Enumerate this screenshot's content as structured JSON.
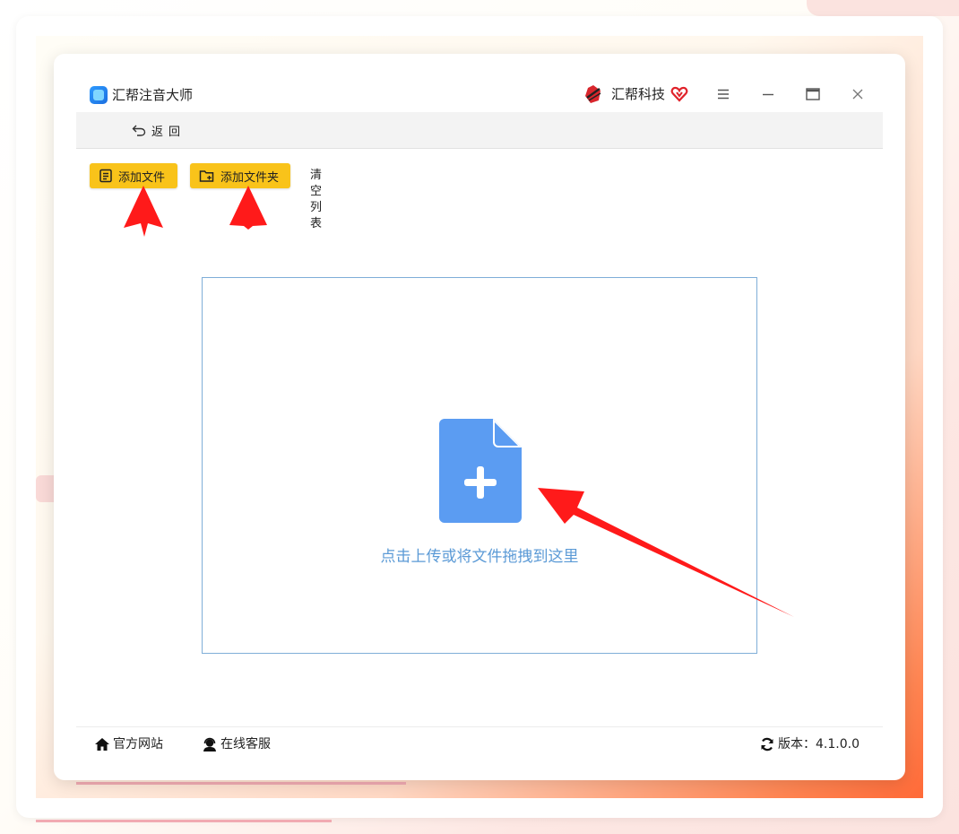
{
  "window": {
    "app_title": "汇帮注音大师",
    "brand_name": "汇帮科技"
  },
  "nav": {
    "back_label": "返回"
  },
  "toolbar": {
    "add_file_label": "添加文件",
    "add_folder_label": "添加文件夹",
    "clear_list_label": "清空列表"
  },
  "dropzone": {
    "text": "点击上传或将文件拖拽到这里"
  },
  "footer": {
    "website_label": "官方网站",
    "support_label": "在线客服",
    "version_prefix": "版本：",
    "version": "4.1.0.0"
  },
  "colors": {
    "accent_yellow": "#f9c31a",
    "drop_blue": "#5b9ad6",
    "file_icon_blue": "#5b9cf2",
    "annotation_red": "#ff1a1a"
  },
  "icons": {
    "menu": "menu-icon",
    "minimize": "minimize-icon",
    "maximize": "maximize-icon",
    "close": "close-icon",
    "back": "back-arrow-icon",
    "add_file": "file-list-icon",
    "add_folder": "folder-plus-icon",
    "dropzone": "file-plus-icon",
    "website": "home-icon",
    "support": "headset-icon",
    "version": "refresh-icon"
  }
}
